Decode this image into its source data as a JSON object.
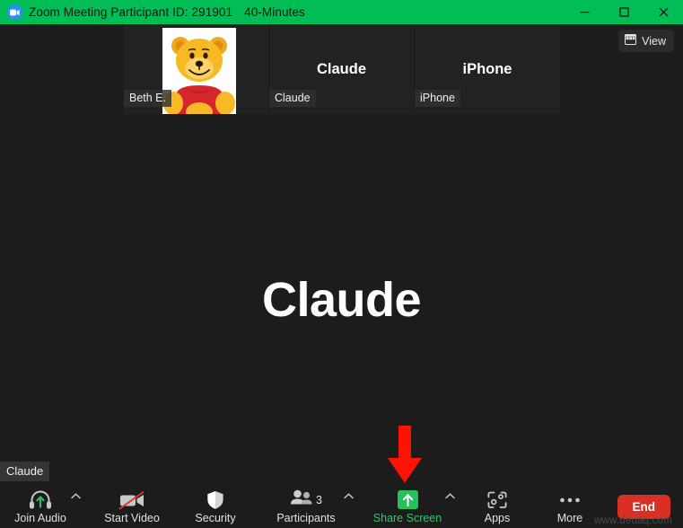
{
  "window": {
    "title": "Zoom Meeting Participant ID: 291901",
    "duration": "40-Minutes",
    "logo_icon": "zoom-camera-icon",
    "minimize_icon": "minimize-icon",
    "maximize_icon": "maximize-icon",
    "close_icon": "close-icon",
    "titlebar_color": "#00bd55"
  },
  "view_button": {
    "label": "View",
    "icon": "grid-view-icon"
  },
  "encryption": {
    "icon": "shield-check-icon",
    "color": "#24c15a"
  },
  "thumbnails": [
    {
      "name_label": "Beth E.",
      "display_name": "",
      "has_photo": true,
      "photo": "winnie-the-pooh-avatar"
    },
    {
      "name_label": "Claude",
      "display_name": "Claude",
      "has_photo": false,
      "photo": ""
    },
    {
      "name_label": "iPhone",
      "display_name": "iPhone",
      "has_photo": false,
      "photo": ""
    }
  ],
  "stage": {
    "active_speaker_name": "Claude",
    "self_label": "Claude"
  },
  "annotation": {
    "arrow": "red-down-arrow",
    "color": "#ff0000",
    "points_at": "Share Screen"
  },
  "toolbar": {
    "items": [
      {
        "label": "Join Audio",
        "icon": "headset-audio-icon",
        "caret": true,
        "badge": "",
        "green_label": false
      },
      {
        "label": "Start Video",
        "icon": "camera-off-icon",
        "caret": false,
        "badge": "",
        "green_label": false
      },
      {
        "label": "Security",
        "icon": "shield-icon",
        "caret": false,
        "badge": "",
        "green_label": false
      },
      {
        "label": "Participants",
        "icon": "people-icon",
        "caret": true,
        "badge": "3",
        "green_label": false
      },
      {
        "label": "Share Screen",
        "icon": "share-screen-icon",
        "caret": true,
        "badge": "",
        "green_label": true
      },
      {
        "label": "Apps",
        "icon": "apps-icon",
        "caret": false,
        "badge": "",
        "green_label": false
      },
      {
        "label": "More",
        "icon": "more-dots-icon",
        "caret": false,
        "badge": "",
        "green_label": false
      }
    ],
    "end_button": "End",
    "end_color": "#d93025"
  },
  "watermark": "www.deuaq.com"
}
